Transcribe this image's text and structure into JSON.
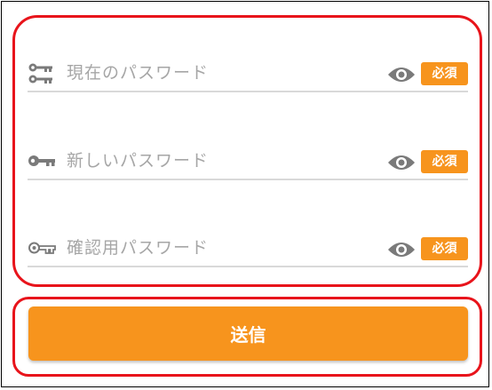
{
  "colors": {
    "accent": "#f7941d",
    "highlight": "#e8141b",
    "placeholder": "#a6a6a6",
    "icon": "#7a7a7a",
    "divider": "#d9d9d9"
  },
  "form": {
    "fields": [
      {
        "placeholder": "現在のパスワード",
        "icon": "double-key-icon",
        "toggle_icon": "eye-icon",
        "badge": "必須"
      },
      {
        "placeholder": "新しいパスワード",
        "icon": "key-icon",
        "toggle_icon": "eye-icon",
        "badge": "必須"
      },
      {
        "placeholder": "確認用パスワード",
        "icon": "outline-key-icon",
        "toggle_icon": "eye-icon",
        "badge": "必須"
      }
    ]
  },
  "submit": {
    "label": "送信"
  }
}
